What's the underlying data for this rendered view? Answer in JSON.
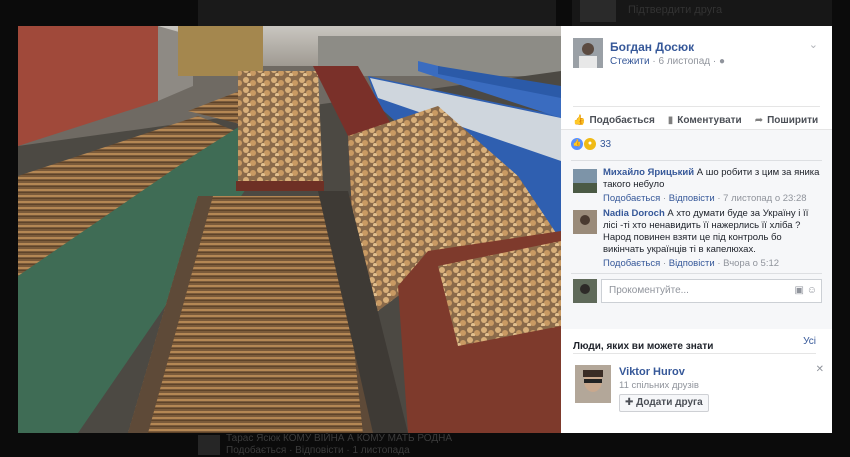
{
  "background_feed": {
    "top_right_text": "Підтвердити друга",
    "bottom_line1": "Тарас Ясюк КОМУ ВІЙНА А КОМУ МАТЬ РОДНА",
    "bottom_line2": "Подобається · Відповісти · 1 листопада"
  },
  "post": {
    "author": "Богдан Досюк",
    "follow_label": "Стежити",
    "date": "6 листопад",
    "privacy_icon": "globe-icon",
    "menu_icon": "chevron-down-icon",
    "photo_description_icon": "photo"
  },
  "actions": {
    "like": "Подобається",
    "comment": "Коментувати",
    "share": "Поширити"
  },
  "reactions": {
    "count": "33",
    "types": [
      "like",
      "angry"
    ]
  },
  "comments": [
    {
      "author": "Михайло Ярицький",
      "text": "А шо робити з цим за яника такого небуло",
      "like": "Подобається",
      "reply": "Відповісти",
      "time": "7 листопад о 23:28"
    },
    {
      "author": "Nadia Doroch",
      "text": "А хто думати буде за Україну і її лісі -ті хто ненавидить її нажерлись її хліба ? Народ повинен взяти це під контроль бо викінчать українців ті в капелюхах.",
      "like": "Подобається",
      "reply": "Відповісти",
      "time": "Вчора о 5:12"
    }
  ],
  "comment_box": {
    "placeholder": "Прокоментуйте..."
  },
  "people_you_may_know": {
    "title": "Люди, яких ви можете знати",
    "see_all": "Усі",
    "person": {
      "name": "Viktor Hurov",
      "mutual": "11 спільних друзів",
      "add_label": "Додати друга"
    }
  },
  "colors": {
    "link": "#365899",
    "like_reaction": "#5890ff",
    "angry_reaction": "#f0ba15",
    "backdrop": "#0b0b0b"
  }
}
